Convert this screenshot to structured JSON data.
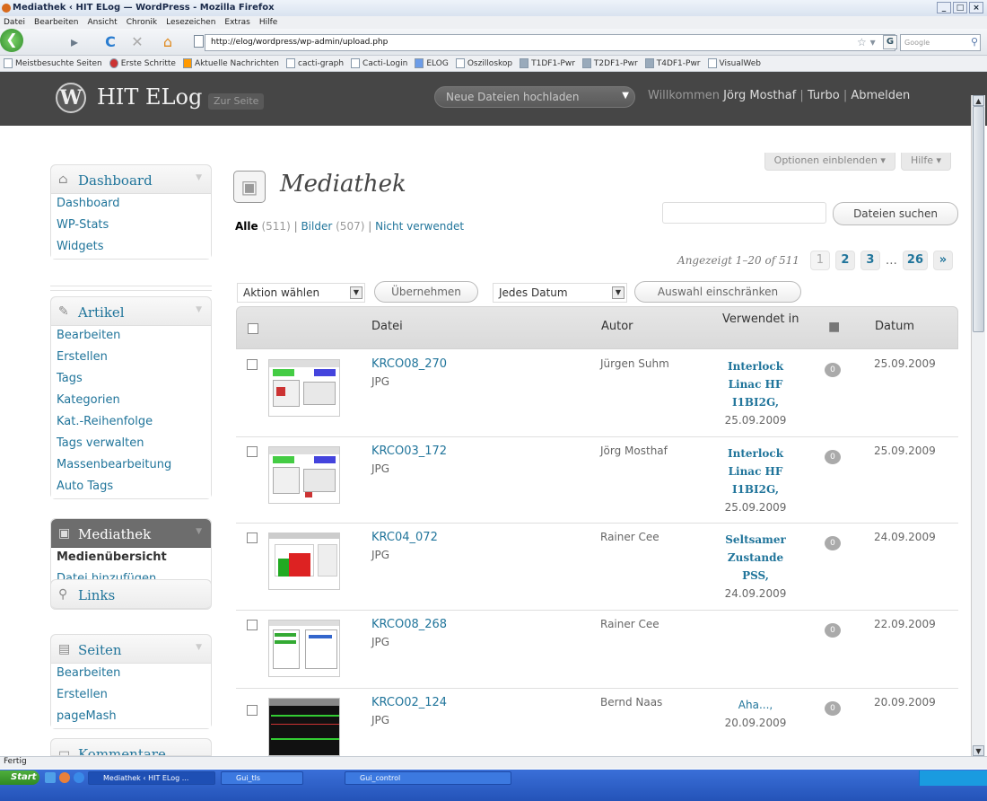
{
  "browser": {
    "window_title": "Mediathek ‹ HIT ELog — WordPress - Mozilla Firefox",
    "menu": [
      "Datei",
      "Bearbeiten",
      "Ansicht",
      "Chronik",
      "Lesezeichen",
      "Extras",
      "Hilfe"
    ],
    "url": "http://elog/wordpress/wp-admin/upload.php",
    "search_placeholder": "Google",
    "bookmarks": [
      "Meistbesuchte Seiten",
      "Erste Schritte",
      "Aktuelle Nachrichten",
      "cacti-graph",
      "Cacti-Login",
      "ELOG",
      "Oszilloskop",
      "T1DF1-Pwr",
      "T2DF1-Pwr",
      "T4DF1-Pwr",
      "VisualWeb"
    ],
    "status": "Fertig"
  },
  "wp_header": {
    "site_title": "HIT ELog",
    "visit_site": "Zur Seite",
    "upload_button": "Neue Dateien hochladen",
    "welcome": "Willkommen",
    "user": "Jörg Mosthaf",
    "turbo": "Turbo",
    "logout": "Abmelden",
    "sep": "|"
  },
  "sidebar": {
    "dashboard": {
      "title": "Dashboard",
      "items": [
        "Dashboard",
        "WP-Stats",
        "Widgets"
      ]
    },
    "artikel": {
      "title": "Artikel",
      "items": [
        "Bearbeiten",
        "Erstellen",
        "Tags",
        "Kategorien",
        "Kat.-Reihenfolge",
        "Tags verwalten",
        "Massenbearbeitung",
        "Auto Tags"
      ]
    },
    "mediathek": {
      "title": "Mediathek",
      "items": [
        "Medienübersicht",
        "Datei hinzufügen"
      ]
    },
    "links": {
      "title": "Links"
    },
    "seiten": {
      "title": "Seiten",
      "items": [
        "Bearbeiten",
        "Erstellen",
        "pageMash"
      ]
    },
    "kommentare": {
      "title": "Kommentare"
    }
  },
  "main": {
    "screen_options": "Optionen einblenden",
    "help": "Hilfe",
    "page_title": "Mediathek",
    "filters": {
      "all": "Alle",
      "all_count": "(511)",
      "images": "Bilder",
      "images_count": "(507)",
      "unattached": "Nicht verwendet"
    },
    "search_button": "Dateien suchen",
    "paging": {
      "displaying": "Angezeigt 1–20 of 511",
      "pages": [
        "1",
        "2",
        "3"
      ],
      "dots": "…",
      "last": "26",
      "next": "»"
    },
    "bulk_action": "Aktion wählen",
    "apply": "Übernehmen",
    "date_filter": "Jedes Datum",
    "filter_button": "Auswahl einschränken",
    "columns": {
      "file": "Datei",
      "author": "Autor",
      "attached": "Verwendet in",
      "date": "Datum"
    },
    "rows": [
      {
        "file": "KRCO08_270",
        "type": "JPG",
        "author": "Jürgen Suhm",
        "attached_title": [
          "Interlock",
          "Linac HF",
          "I1BI2G,"
        ],
        "attached_date": "25.09.2009",
        "comments": "0",
        "date": "25.09.2009"
      },
      {
        "file": "KRCO03_172",
        "type": "JPG",
        "author": "Jörg Mosthaf",
        "attached_title": [
          "Interlock",
          "Linac HF",
          "I1BI2G,"
        ],
        "attached_date": "25.09.2009",
        "comments": "0",
        "date": "25.09.2009"
      },
      {
        "file": "KRC04_072",
        "type": "JPG",
        "author": "Rainer Cee",
        "attached_title": [
          "Seltsamer",
          "Zustande",
          "PSS,"
        ],
        "attached_date": "24.09.2009",
        "comments": "0",
        "date": "24.09.2009"
      },
      {
        "file": "KRCO08_268",
        "type": "JPG",
        "author": "Rainer Cee",
        "attached_title": [],
        "attached_date": "",
        "comments": "0",
        "date": "22.09.2009"
      },
      {
        "file": "KRCO02_124",
        "type": "JPG",
        "author": "Bernd Naas",
        "attached_title": [
          "Aha...,"
        ],
        "attached_date": "20.09.2009",
        "comments": "0",
        "date": "20.09.2009"
      }
    ]
  },
  "taskbar": {
    "start": "Start",
    "tasks": [
      "Mediathek ‹ HIT ELog ...",
      "Gui_tls",
      "Gui_control"
    ]
  }
}
